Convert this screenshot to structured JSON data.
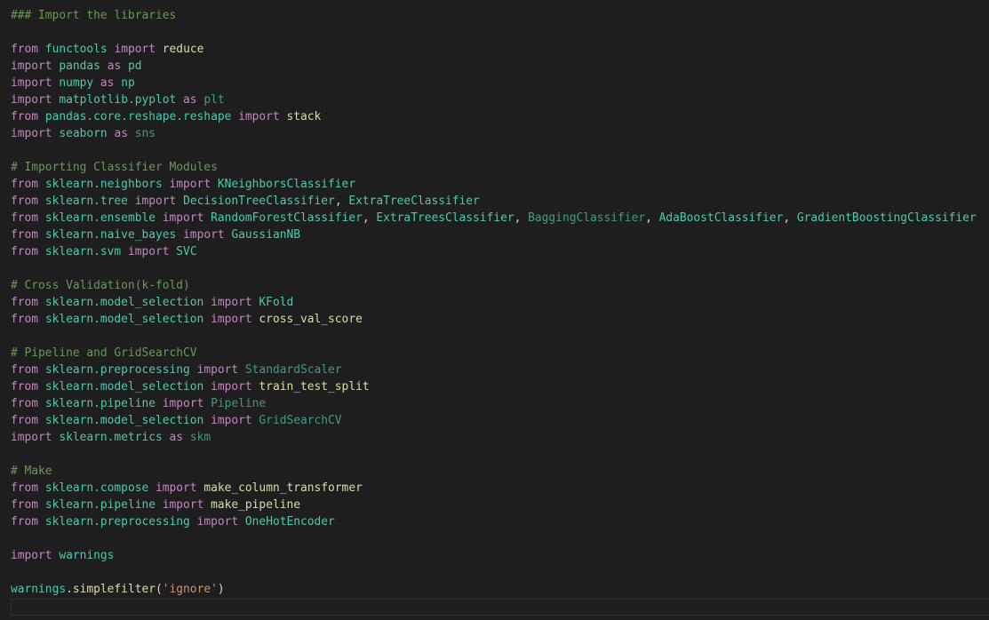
{
  "editor": {
    "lines": [
      [
        {
          "t": "### Import the libraries",
          "c": "cmt"
        }
      ],
      [],
      [
        {
          "t": "from",
          "c": "kw"
        },
        {
          "t": " "
        },
        {
          "t": "functools",
          "c": "mod"
        },
        {
          "t": " "
        },
        {
          "t": "import",
          "c": "kw"
        },
        {
          "t": " "
        },
        {
          "t": "reduce",
          "c": "fn"
        }
      ],
      [
        {
          "t": "import",
          "c": "kw"
        },
        {
          "t": " "
        },
        {
          "t": "pandas",
          "c": "mod"
        },
        {
          "t": " "
        },
        {
          "t": "as",
          "c": "kw"
        },
        {
          "t": " "
        },
        {
          "t": "pd",
          "c": "mod"
        }
      ],
      [
        {
          "t": "import",
          "c": "kw"
        },
        {
          "t": " "
        },
        {
          "t": "numpy",
          "c": "mod"
        },
        {
          "t": " "
        },
        {
          "t": "as",
          "c": "kw"
        },
        {
          "t": " "
        },
        {
          "t": "np",
          "c": "mod"
        }
      ],
      [
        {
          "t": "import",
          "c": "kw"
        },
        {
          "t": " "
        },
        {
          "t": "matplotlib.pyplot",
          "c": "mod"
        },
        {
          "t": " "
        },
        {
          "t": "as",
          "c": "kw"
        },
        {
          "t": " "
        },
        {
          "t": "plt",
          "c": "cls2"
        }
      ],
      [
        {
          "t": "from",
          "c": "kw"
        },
        {
          "t": " "
        },
        {
          "t": "pandas.core.reshape.reshape",
          "c": "mod"
        },
        {
          "t": " "
        },
        {
          "t": "import",
          "c": "kw"
        },
        {
          "t": " "
        },
        {
          "t": "stack",
          "c": "fn"
        }
      ],
      [
        {
          "t": "import",
          "c": "kw"
        },
        {
          "t": " "
        },
        {
          "t": "seaborn",
          "c": "mod"
        },
        {
          "t": " "
        },
        {
          "t": "as",
          "c": "kw"
        },
        {
          "t": " "
        },
        {
          "t": "sns",
          "c": "cls2"
        }
      ],
      [],
      [
        {
          "t": "# Importing Classifier Modules",
          "c": "cmt"
        }
      ],
      [
        {
          "t": "from",
          "c": "kw"
        },
        {
          "t": " "
        },
        {
          "t": "sklearn.neighbors",
          "c": "mod"
        },
        {
          "t": " "
        },
        {
          "t": "import",
          "c": "kw"
        },
        {
          "t": " "
        },
        {
          "t": "KNeighborsClassifier",
          "c": "cls"
        }
      ],
      [
        {
          "t": "from",
          "c": "kw"
        },
        {
          "t": " "
        },
        {
          "t": "sklearn.tree",
          "c": "mod"
        },
        {
          "t": " "
        },
        {
          "t": "import",
          "c": "kw"
        },
        {
          "t": " "
        },
        {
          "t": "DecisionTreeClassifier",
          "c": "cls"
        },
        {
          "t": ", "
        },
        {
          "t": "ExtraTreeClassifier",
          "c": "cls"
        }
      ],
      [
        {
          "t": "from",
          "c": "kw"
        },
        {
          "t": " "
        },
        {
          "t": "sklearn.ensemble",
          "c": "mod"
        },
        {
          "t": " "
        },
        {
          "t": "import",
          "c": "kw"
        },
        {
          "t": " "
        },
        {
          "t": "RandomForestClassifier",
          "c": "cls"
        },
        {
          "t": ", "
        },
        {
          "t": "ExtraTreesClassifier",
          "c": "cls"
        },
        {
          "t": ", "
        },
        {
          "t": "BaggingClassifier",
          "c": "cls2"
        },
        {
          "t": ", "
        },
        {
          "t": "AdaBoostClassifier",
          "c": "cls"
        },
        {
          "t": ", "
        },
        {
          "t": "GradientBoostingClassifier",
          "c": "cls"
        }
      ],
      [
        {
          "t": "from",
          "c": "kw"
        },
        {
          "t": " "
        },
        {
          "t": "sklearn.naive_bayes",
          "c": "mod"
        },
        {
          "t": " "
        },
        {
          "t": "import",
          "c": "kw"
        },
        {
          "t": " "
        },
        {
          "t": "GaussianNB",
          "c": "cls"
        }
      ],
      [
        {
          "t": "from",
          "c": "kw"
        },
        {
          "t": " "
        },
        {
          "t": "sklearn.svm",
          "c": "mod"
        },
        {
          "t": " "
        },
        {
          "t": "import",
          "c": "kw"
        },
        {
          "t": " "
        },
        {
          "t": "SVC",
          "c": "cls"
        }
      ],
      [],
      [
        {
          "t": "# Cross Validation(k-fold)",
          "c": "cmt"
        }
      ],
      [
        {
          "t": "from",
          "c": "kw"
        },
        {
          "t": " "
        },
        {
          "t": "sklearn.model_selection",
          "c": "mod"
        },
        {
          "t": " "
        },
        {
          "t": "import",
          "c": "kw"
        },
        {
          "t": " "
        },
        {
          "t": "KFold",
          "c": "cls"
        }
      ],
      [
        {
          "t": "from",
          "c": "kw"
        },
        {
          "t": " "
        },
        {
          "t": "sklearn.model_selection",
          "c": "mod"
        },
        {
          "t": " "
        },
        {
          "t": "import",
          "c": "kw"
        },
        {
          "t": " "
        },
        {
          "t": "cross_val_score",
          "c": "fn"
        }
      ],
      [],
      [
        {
          "t": "# Pipeline and GridSearchCV",
          "c": "cmt"
        }
      ],
      [
        {
          "t": "from",
          "c": "kw"
        },
        {
          "t": " "
        },
        {
          "t": "sklearn.preprocessing",
          "c": "mod"
        },
        {
          "t": " "
        },
        {
          "t": "import",
          "c": "kw"
        },
        {
          "t": " "
        },
        {
          "t": "StandardScaler",
          "c": "cls2"
        }
      ],
      [
        {
          "t": "from",
          "c": "kw"
        },
        {
          "t": " "
        },
        {
          "t": "sklearn.model_selection",
          "c": "mod"
        },
        {
          "t": " "
        },
        {
          "t": "import",
          "c": "kw"
        },
        {
          "t": " "
        },
        {
          "t": "train_test_split",
          "c": "fn"
        }
      ],
      [
        {
          "t": "from",
          "c": "kw"
        },
        {
          "t": " "
        },
        {
          "t": "sklearn.pipeline",
          "c": "mod"
        },
        {
          "t": " "
        },
        {
          "t": "import",
          "c": "kw"
        },
        {
          "t": " "
        },
        {
          "t": "Pipeline",
          "c": "cls2"
        }
      ],
      [
        {
          "t": "from",
          "c": "kw"
        },
        {
          "t": " "
        },
        {
          "t": "sklearn.model_selection",
          "c": "mod"
        },
        {
          "t": " "
        },
        {
          "t": "import",
          "c": "kw"
        },
        {
          "t": " "
        },
        {
          "t": "GridSearchCV",
          "c": "cls2"
        }
      ],
      [
        {
          "t": "import",
          "c": "kw"
        },
        {
          "t": " "
        },
        {
          "t": "sklearn.metrics",
          "c": "mod"
        },
        {
          "t": " "
        },
        {
          "t": "as",
          "c": "kw"
        },
        {
          "t": " "
        },
        {
          "t": "skm",
          "c": "cls2"
        }
      ],
      [],
      [
        {
          "t": "# Make",
          "c": "cmt"
        }
      ],
      [
        {
          "t": "from",
          "c": "kw"
        },
        {
          "t": " "
        },
        {
          "t": "sklearn.compose",
          "c": "mod"
        },
        {
          "t": " "
        },
        {
          "t": "import",
          "c": "kw"
        },
        {
          "t": " "
        },
        {
          "t": "make_column_transformer",
          "c": "fn"
        }
      ],
      [
        {
          "t": "from",
          "c": "kw"
        },
        {
          "t": " "
        },
        {
          "t": "sklearn.pipeline",
          "c": "mod"
        },
        {
          "t": " "
        },
        {
          "t": "import",
          "c": "kw"
        },
        {
          "t": " "
        },
        {
          "t": "make_pipeline",
          "c": "fn"
        }
      ],
      [
        {
          "t": "from",
          "c": "kw"
        },
        {
          "t": " "
        },
        {
          "t": "sklearn.preprocessing",
          "c": "mod"
        },
        {
          "t": " "
        },
        {
          "t": "import",
          "c": "kw"
        },
        {
          "t": " "
        },
        {
          "t": "OneHotEncoder",
          "c": "cls"
        }
      ],
      [],
      [
        {
          "t": "import",
          "c": "kw"
        },
        {
          "t": " "
        },
        {
          "t": "warnings",
          "c": "mod"
        }
      ],
      [],
      [
        {
          "t": "warnings",
          "c": "mod"
        },
        {
          "t": "."
        },
        {
          "t": "simplefilter",
          "c": "fn"
        },
        {
          "t": "("
        },
        {
          "t": "'ignore'",
          "c": "str"
        },
        {
          "t": ")"
        }
      ]
    ]
  }
}
